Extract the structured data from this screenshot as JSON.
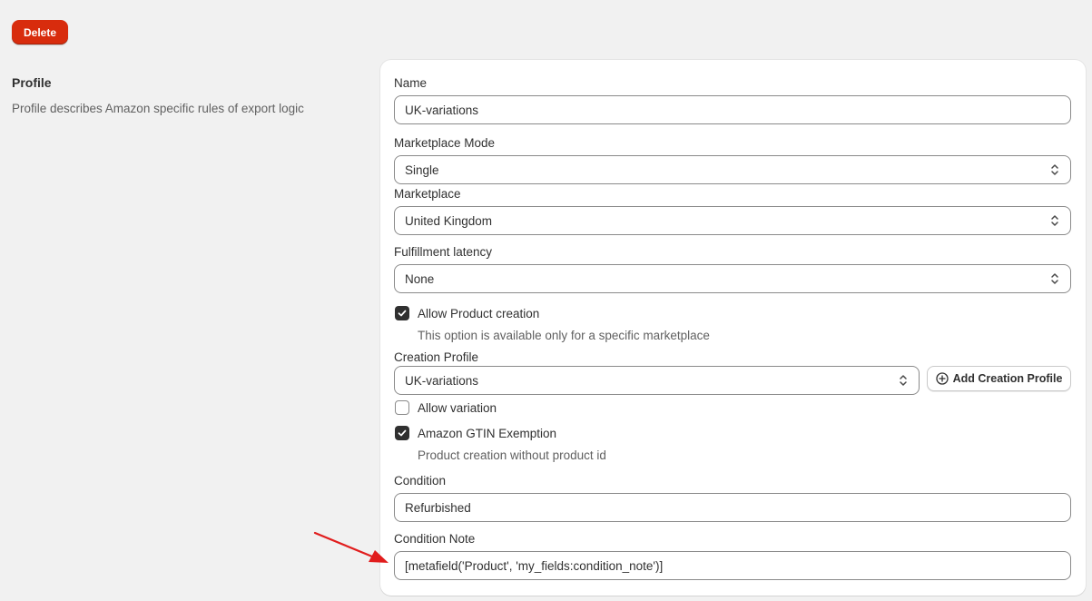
{
  "header": {
    "delete_label": "Delete"
  },
  "section": {
    "title": "Profile",
    "description": "Profile describes Amazon specific rules of export logic"
  },
  "form": {
    "name": {
      "label": "Name",
      "value": "UK-variations"
    },
    "marketplace_mode": {
      "label": "Marketplace Mode",
      "value": "Single"
    },
    "marketplace": {
      "label": "Marketplace",
      "value": "United Kingdom"
    },
    "fulfillment_latency": {
      "label": "Fulfillment latency",
      "value": "None"
    },
    "allow_product_creation": {
      "label": "Allow Product creation",
      "checked": true,
      "help": "This option is available only for a specific marketplace"
    },
    "creation_profile": {
      "label": "Creation Profile",
      "value": "UK-variations",
      "add_label": "Add Creation Profile"
    },
    "allow_variation": {
      "label": "Allow variation",
      "checked": false
    },
    "gtin_exemption": {
      "label": "Amazon GTIN Exemption",
      "checked": true,
      "help": "Product creation without product id"
    },
    "condition": {
      "label": "Condition",
      "value": "Refurbished"
    },
    "condition_note": {
      "label": "Condition Note",
      "value": "[metafield('Product', 'my_fields:condition_note')]"
    }
  },
  "icons": {
    "select_chevron": "chevron-up-down-icon",
    "checkmark": "checkmark-icon",
    "add": "plus-circle-icon",
    "annotation": "red-arrow-icon"
  },
  "colors": {
    "danger": "#d82c0d",
    "annotation": "#e11d1d",
    "checkbox": "#303030"
  }
}
